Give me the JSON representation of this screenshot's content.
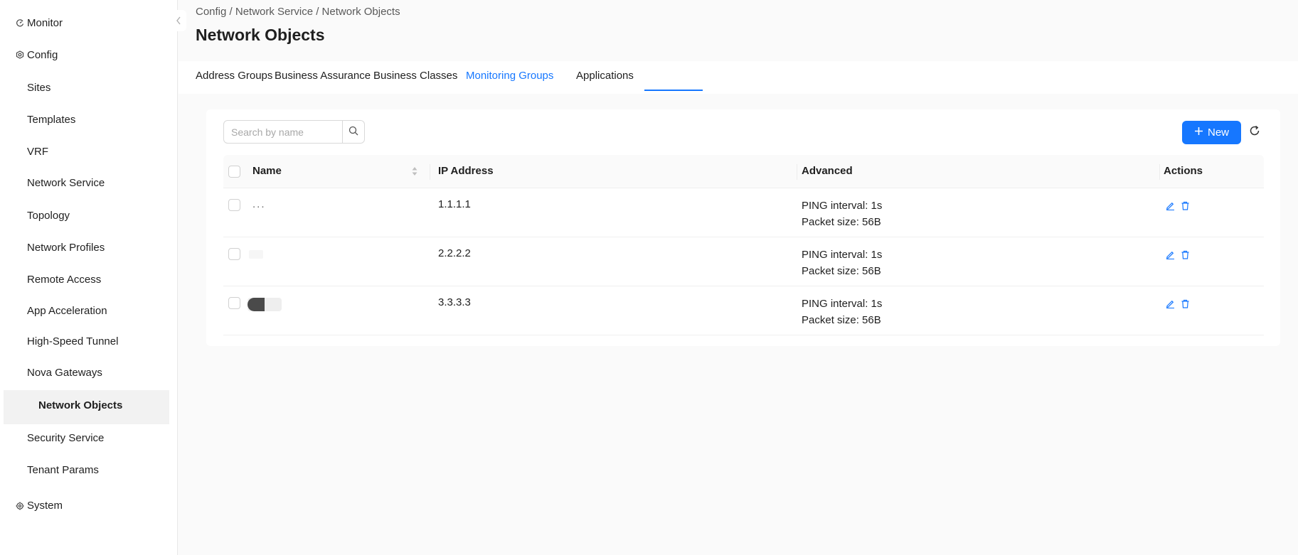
{
  "sidebar": {
    "monitor": "Monitor",
    "config": "Config",
    "items": [
      {
        "label": "Sites"
      },
      {
        "label": "Templates"
      },
      {
        "label": "VRF"
      },
      {
        "label": "Network Service"
      },
      {
        "label": "Topology"
      },
      {
        "label": "Network Profiles"
      },
      {
        "label": "Remote Access"
      },
      {
        "label": "App Acceleration"
      },
      {
        "label": "High-Speed Tunnel"
      },
      {
        "label": "Nova Gateways"
      },
      {
        "label": "Network Objects"
      },
      {
        "label": "Security Service"
      },
      {
        "label": "Tenant Params"
      }
    ],
    "active_item": "Network Objects",
    "system": "System"
  },
  "breadcrumb": "Config / Network Service / Network Objects",
  "page_title": "Network Objects",
  "tabs": [
    {
      "label": "Address Groups"
    },
    {
      "label": "Business Assurance"
    },
    {
      "label": "Business Classes"
    },
    {
      "label": "Monitoring Groups"
    },
    {
      "label": "Applications"
    }
  ],
  "active_tab": "Monitoring Groups",
  "search": {
    "placeholder": "Search by name",
    "value": ""
  },
  "toolbar": {
    "new_label": "New"
  },
  "table": {
    "columns": [
      "Name",
      "IP Address",
      "Advanced",
      "Actions"
    ],
    "rows": [
      {
        "name": "...",
        "ip": "1.1.1.1",
        "advanced_line1": "PING interval: 1s",
        "advanced_line2": "Packet size: 56B"
      },
      {
        "name": "",
        "ip": "2.2.2.2",
        "advanced_line1": "PING interval: 1s",
        "advanced_line2": "Packet size: 56B"
      },
      {
        "name": "",
        "ip": "3.3.3.3",
        "advanced_line1": "PING interval: 1s",
        "advanced_line2": "Packet size: 56B"
      }
    ]
  },
  "colors": {
    "accent": "#1677ff",
    "active_nav_bg": "#f2f2f2",
    "text": "#1f1f1f"
  },
  "icons": [
    "monitor-icon",
    "config-icon",
    "system-icon",
    "collapse-chevron-icon",
    "search-icon",
    "plus-icon",
    "refresh-icon",
    "sort-icon",
    "edit-icon",
    "delete-icon"
  ]
}
